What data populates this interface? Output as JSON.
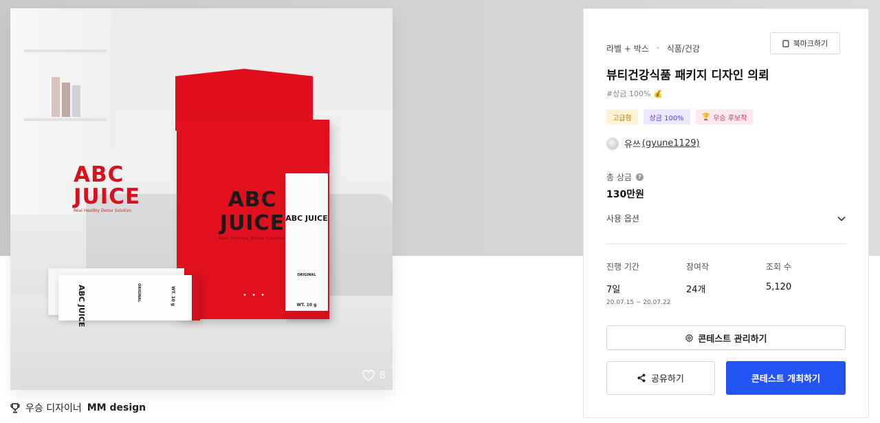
{
  "product_image": {
    "left_logo": "ABC JUICE",
    "left_logo_sub": "Real Healthy Detox Solution",
    "box_logo": "ABC JUICE",
    "box_logo_sub": "Real Healthy Detox Solution",
    "stick_logo": "ABC JUICE",
    "stick_variant": "ORIGINAL",
    "stick_weight": "WT. 10 g",
    "like_count": "8"
  },
  "designer": {
    "label": "우승 디자이너",
    "name": "MM design"
  },
  "info": {
    "category_1": "라벨 + 박스",
    "category_2": "식품/건강",
    "bookmark_label": "북마크하기",
    "title": "뷰티건강식품 패키지 디자인 의뢰",
    "sub_tag": "#상금 100%",
    "badges": {
      "grade": "고급형",
      "prize": "상금 100%",
      "winner": "우승 후보작"
    },
    "user": {
      "name": "유쓰",
      "id": "(gyune1129)"
    },
    "total_prize_label": "총 상금",
    "total_prize_value": "130만원",
    "usage_option_label": "사용 옵션",
    "stats": {
      "duration_label": "진행 기간",
      "duration_value": "7일",
      "duration_range": "20.07.15 ~ 20.07.22",
      "participants_label": "참여작",
      "participants_value": "24개",
      "views_label": "조회 수",
      "views_value": "5,120"
    },
    "manage_button": "콘테스트 관리하기",
    "share_button": "공유하기",
    "host_button": "콘테스트 개최하기"
  },
  "colors": {
    "primary": "#2554f5",
    "brand_red": "#e0101e"
  }
}
